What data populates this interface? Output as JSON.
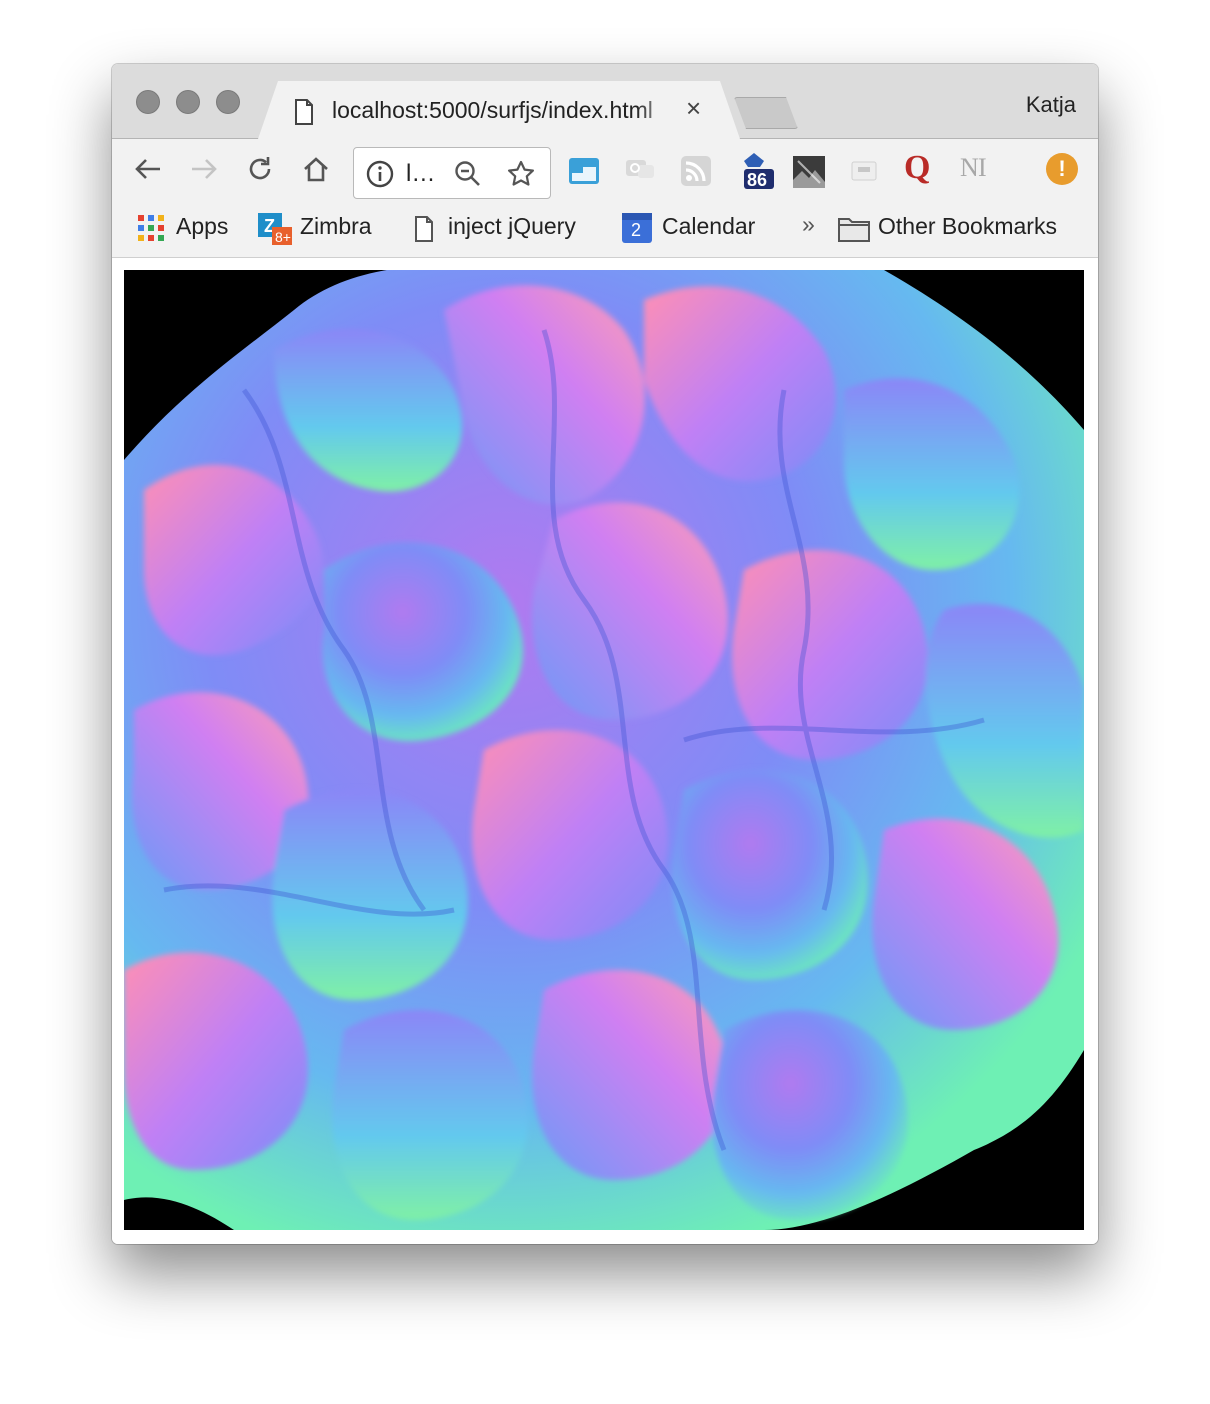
{
  "window": {
    "tab": {
      "title": "localhost:5000/surfjs/index.html",
      "close_label": "×"
    },
    "profile": "Katja"
  },
  "toolbar": {
    "omnibox_text": "l…",
    "extensions": [
      {
        "icon": "window-app-icon"
      },
      {
        "icon": "chat-icon"
      },
      {
        "icon": "rss-icon"
      },
      {
        "icon": "counter-icon",
        "badge": "86"
      },
      {
        "icon": "photo-gallery-icon"
      },
      {
        "icon": "pdf-tool-icon"
      },
      {
        "icon": "quora-q-icon",
        "label": "Q"
      },
      {
        "icon": "noodle-text-icon",
        "label": "N"
      },
      {
        "icon": "alert-icon",
        "label": "!"
      }
    ]
  },
  "bookmarks": {
    "apps": "Apps",
    "zimbra": "Zimbra",
    "inject_jquery": "inject jQuery",
    "calendar": "Calendar",
    "calendar_badge": "2",
    "overflow": "»",
    "other": "Other Bookmarks"
  },
  "content": {
    "canvas_background": "#000000",
    "render": "normal-mapped brain surface"
  },
  "colors": {
    "tab_strip": "#dcdcdc",
    "toolbar": "#f2f2f2",
    "alert": "#e89c2d",
    "quora": "#b92b27"
  }
}
